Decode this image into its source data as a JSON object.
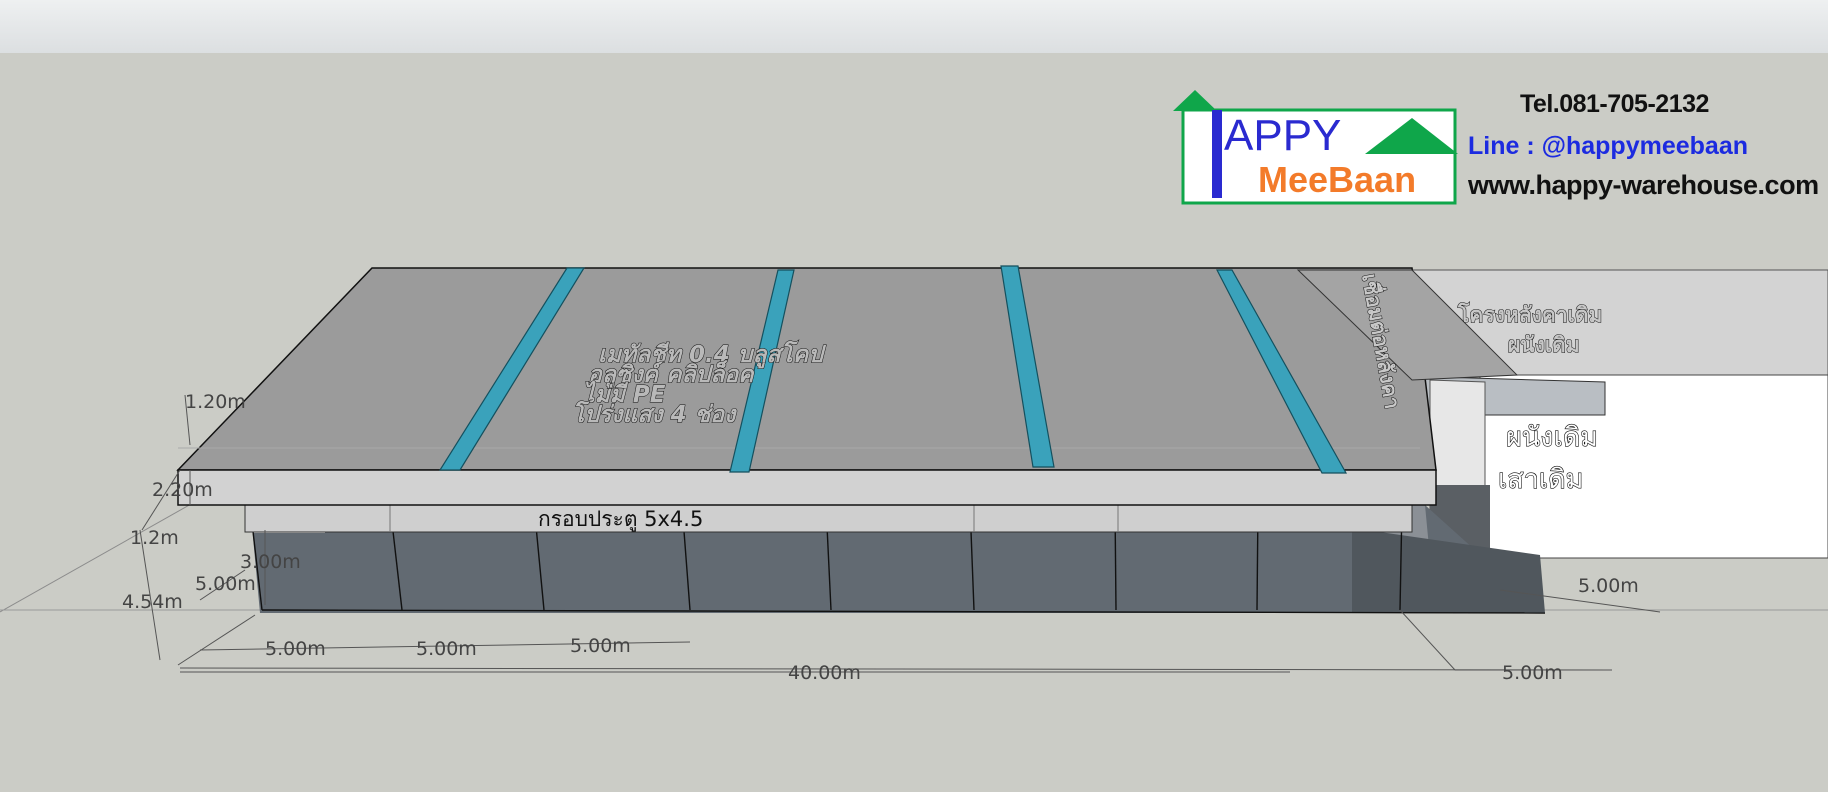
{
  "brand": {
    "logo_line1": "APPY",
    "logo_letter": "H",
    "logo_line2": "MeeBaan",
    "tel": "Tel.081-705-2132",
    "line": "Line :  @happymeebaan",
    "website": "www.happy-warehouse.com",
    "colors": {
      "green": "#0fa64a",
      "blue": "#2a2ad0",
      "orange": "#f37b2a"
    }
  },
  "annotations": {
    "roof_spec": [
      "เมทัลชีท 0.4 บลูสโคป",
      "อลูซิงค์ คลิปล็อค",
      "ไม่มี PE",
      "โปร่งแสง 4 ช่อง"
    ],
    "existing_roof": [
      "โครงหลังคาเดิม",
      "ผนังเดิม"
    ],
    "side_label": "เชื่อมต่อหลังคา",
    "existing_wall": "ผนังเดิม",
    "existing_post": "เสาเดิม",
    "door_frame": "กรอบประตู 5x4.5"
  },
  "dimensions": {
    "d_1_20_top": "1.20m",
    "d_2_20": "2.20m",
    "d_1_2": "1.2m",
    "d_3_00": "3.00m",
    "d_5_00_side": "5.00m",
    "d_4_54": "4.54m",
    "bay1": "5.00m",
    "bay2": "5.00m",
    "bay3": "5.00m",
    "total": "40.00m",
    "ext_bottom": "5.00m",
    "ext_right": "5.00m"
  },
  "colors": {
    "roof_top": "#9b9b9b",
    "roof_edge": "#d2d2d2",
    "skylight": "#3aa2bb",
    "interior": "#626a72",
    "background": "#cbccc6"
  }
}
